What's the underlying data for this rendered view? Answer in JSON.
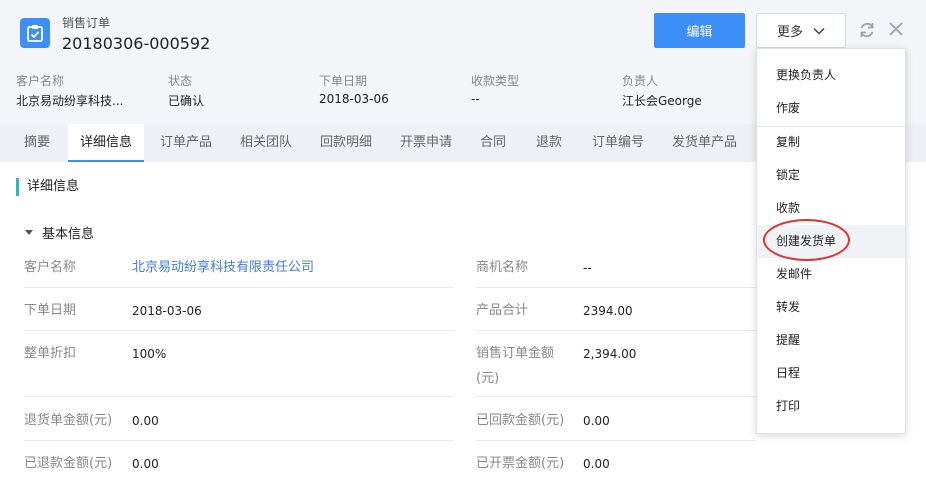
{
  "header": {
    "order_type": "销售订单",
    "order_no": "20180306-000592",
    "edit_label": "编辑",
    "more_label": "更多"
  },
  "summary": [
    {
      "label": "客户名称",
      "value": "北京易动纷享科技..."
    },
    {
      "label": "状态",
      "value": "已确认"
    },
    {
      "label": "下单日期",
      "value": "2018-03-06"
    },
    {
      "label": "收款类型",
      "value": "--"
    },
    {
      "label": "负责人",
      "value": "江长会George"
    }
  ],
  "tabs": [
    "摘要",
    "详细信息",
    "订单产品",
    "相关团队",
    "回款明细",
    "开票申请",
    "合同",
    "退款",
    "订单编号",
    "发货单产品"
  ],
  "active_tab": "详细信息",
  "section_title": "详细信息",
  "group_title": "基本信息",
  "fields": [
    {
      "label": "客户名称",
      "value": "北京易动纷享科技有限责任公司"
    },
    {
      "label": "商机名称",
      "value": "--"
    },
    {
      "label": "下单日期",
      "value": "2018-03-06"
    },
    {
      "label": "产品合计",
      "value": "2394.00"
    },
    {
      "label": "整单折扣",
      "value": "100%"
    },
    {
      "label": "销售订单金额",
      "label2": "(元)",
      "value": "2,394.00"
    },
    {
      "label": "退货单金额(元)",
      "value": "0.00"
    },
    {
      "label": "已回款金额(元)",
      "value": "0.00"
    },
    {
      "label": "已退款金额(元)",
      "value": "0.00"
    },
    {
      "label": "已开票金额(元)",
      "value": "0.00"
    }
  ],
  "menu": [
    "更换负责人",
    "作废",
    "复制",
    "锁定",
    "收款",
    "创建发货单",
    "发邮件",
    "转发",
    "提醒",
    "日程",
    "打印"
  ],
  "menu_highlighted": "创建发货单",
  "colors": {
    "accent": "#3e8ef7",
    "section_bar": "#2dbab6",
    "link": "#3e7be0",
    "annotation": "#e0322e"
  }
}
